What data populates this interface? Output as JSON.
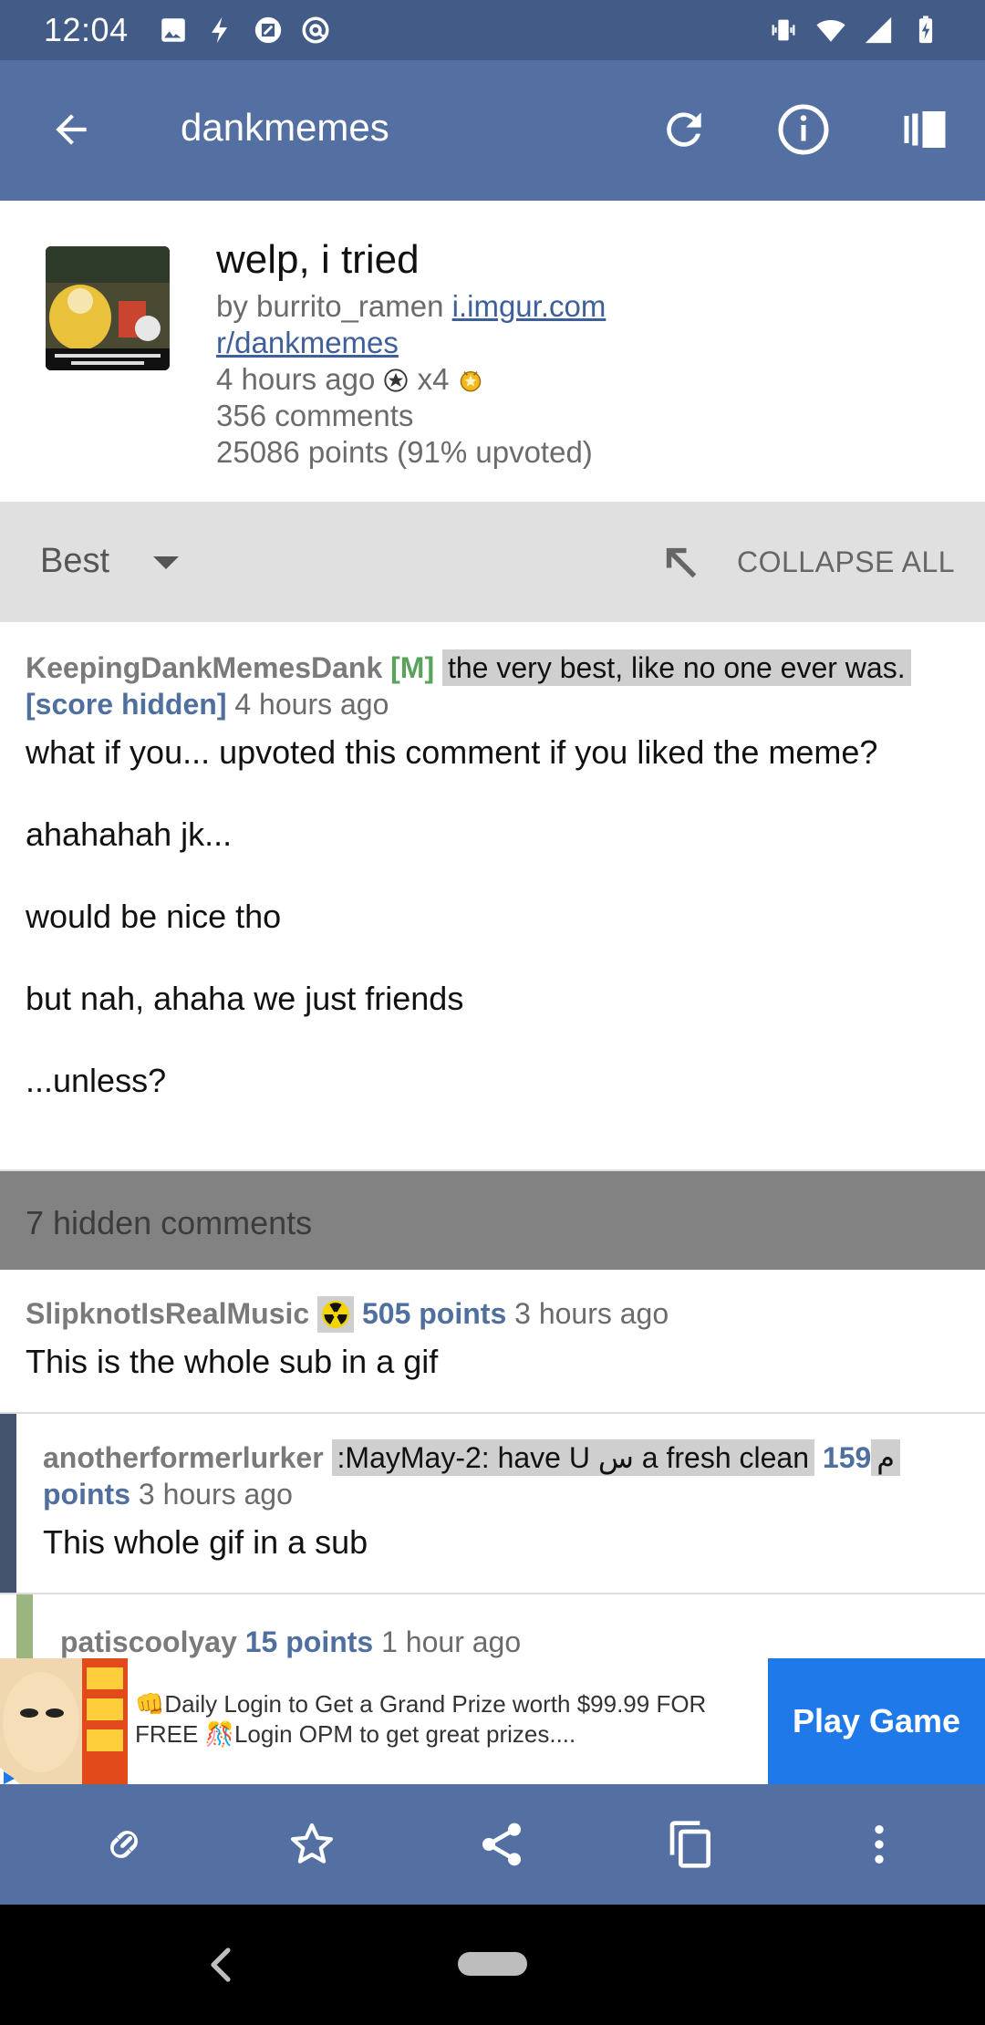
{
  "status_bar": {
    "time": "12:04",
    "left_icons": [
      "image-icon",
      "flash-icon",
      "screenshot-icon",
      "at-sign-icon"
    ],
    "right_icons": [
      "vibrate-icon",
      "wifi-icon",
      "signal-icon",
      "battery-charging-icon"
    ]
  },
  "app_bar": {
    "title": "dankmemes",
    "actions": [
      "refresh-icon",
      "info-icon",
      "sidebar-icon"
    ]
  },
  "post": {
    "title": "welp, i tried",
    "by_prefix": "by burrito_ramen ",
    "domain": "i.imgur.com",
    "subreddit": "r/dankmemes",
    "age": "4 hours ago",
    "award_multiplier": "x4",
    "comments": "356 comments",
    "points": "25086 points (91% upvoted)"
  },
  "sort_bar": {
    "sort": "Best",
    "collapse_label": "COLLAPSE ALL"
  },
  "comments": [
    {
      "author": "KeepingDankMemesDank",
      "mod_tag": "[M]",
      "flair": "the very best, like no one ever was.",
      "score": "[score hidden]",
      "age": "4 hours ago",
      "body": [
        "what if you... upvoted this comment if you liked the meme?",
        "ahahahah jk...",
        "would be nice tho",
        "but nah, ahaha we just friends",
        "...unless?"
      ]
    },
    {
      "author": "SlipknotIsRealMusic",
      "score": "505 points",
      "age": "3 hours ago",
      "body": [
        "This is the whole sub in a gif"
      ]
    },
    {
      "author": "anotherformerlurker",
      "flair": ":MayMay-2: have U س a fresh clean",
      "flair_tail": "م",
      "score": "159 points",
      "age": "3 hours ago",
      "body": [
        "This whole gif in a sub"
      ]
    },
    {
      "author": "patiscoolyay",
      "score": "15 points",
      "age": "1 hour ago"
    }
  ],
  "hidden_comments": "7 hidden comments",
  "ad": {
    "text": "👊Daily Login to Get a Grand Prize worth $99.99 FOR FREE 🎊Login OPM to get great prizes....",
    "button": "Play Game"
  },
  "toolbar": [
    "link-icon",
    "star-icon",
    "share-icon",
    "copy-icon",
    "more-vert-icon"
  ],
  "colors": {
    "status_bar": "#425b87",
    "app_bar": "#5470a3",
    "score": "#4f6f9f",
    "mod": "#5aa35a",
    "ad_button": "#1f79e8"
  }
}
